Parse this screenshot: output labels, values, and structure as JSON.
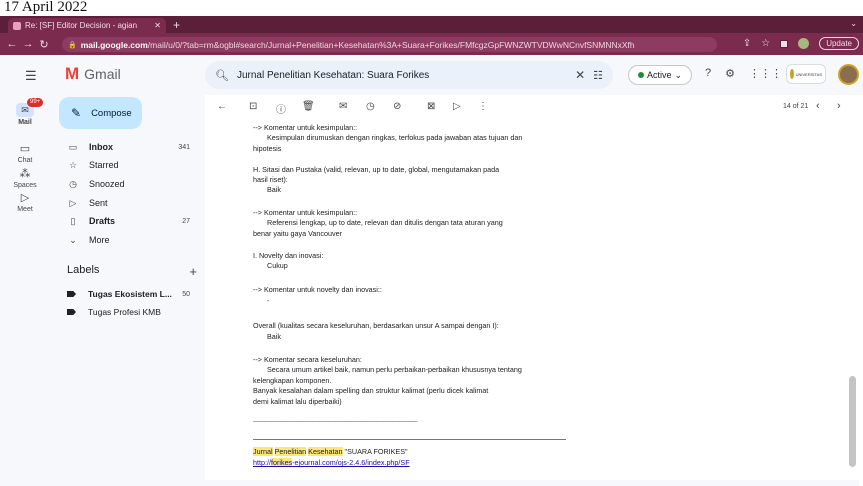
{
  "page_header": {
    "text": "17 April 2022"
  },
  "browser": {
    "tab_title": "Re: [SF] Editor Decision - agian",
    "url_host": "mail.google.com",
    "url_path": "/mail/u/0/?tab=rm&ogbl#search/Jurnal+Penelitian+Kesehatan%3A+Suara+Forikes/FMfcgzGpFWNZWTVDWwNCnvfSNMNNxXfh",
    "update_label": "Update"
  },
  "gmail": {
    "app_name": "Gmail",
    "search_value": "Jurnal Penelitian Kesehatan: Suara Forikes",
    "status_label": "Active",
    "univ_text": "UNIVERSITAS"
  },
  "rail": {
    "mail_label": "Mail",
    "mail_badge": "99+",
    "chat_label": "Chat",
    "spaces_label": "Spaces",
    "meet_label": "Meet"
  },
  "sidebar": {
    "compose_label": "Compose",
    "items": [
      {
        "label": "Inbox",
        "count": "341"
      },
      {
        "label": "Starred",
        "count": ""
      },
      {
        "label": "Snoozed",
        "count": ""
      },
      {
        "label": "Sent",
        "count": ""
      },
      {
        "label": "Drafts",
        "count": "27"
      },
      {
        "label": "More",
        "count": ""
      }
    ],
    "labels_title": "Labels",
    "labels": [
      {
        "label": "Tugas Ekosistem L...",
        "count": "50"
      },
      {
        "label": "Tugas Profesi KMB",
        "count": ""
      }
    ]
  },
  "toolbar": {
    "pager_text": "14 of 21"
  },
  "message": {
    "lines": [
      "--> Komentar untuk kesimpulan::",
      "Kesimpulan dirumuskan dengan ringkas, terfokus pada jawaban atas tujuan dan",
      "hipotesis",
      "H. Sitasi dan Pustaka (valid, relevan, up to date, global, mengutamakan pada",
      "hasil riset):",
      "Baik",
      "--> Komentar untuk kesimpulan::",
      "Referensi lengkap, up to date, relevan dan ditulis dengan tata aturan yang",
      "benar yaitu gaya Vancouver",
      "I. Novelty dan inovasi:",
      "Cukup",
      "--> Komentar untuk novelty dan inovasi::",
      "-",
      "Overall (kualitas secara keseluruhan, berdasarkan unsur A sampai dengan I):",
      "Baik",
      "--> Komentar secara keseluruhan:",
      "Secara umum artikel baik, namun perlu perbaikan-perbaikan khususnya tentang",
      "kelengkapan komponen.",
      "Banyak kesalahan dalam spelling dan struktur kalimat (perlu dicek kalimat",
      "demi kalimat lalu diperbaiki)",
      "________________________________________________________________________"
    ],
    "signature": {
      "w1": "Jurnal",
      "w2": "Penelitian",
      "w3": "Kesehatan",
      "quoted": "SUARA FORIKES",
      "link_prefix": "http://",
      "link_highlight": "forikes",
      "link_suffix": "-ejournal.com/ojs-2.4.6/index.php/SF"
    }
  }
}
